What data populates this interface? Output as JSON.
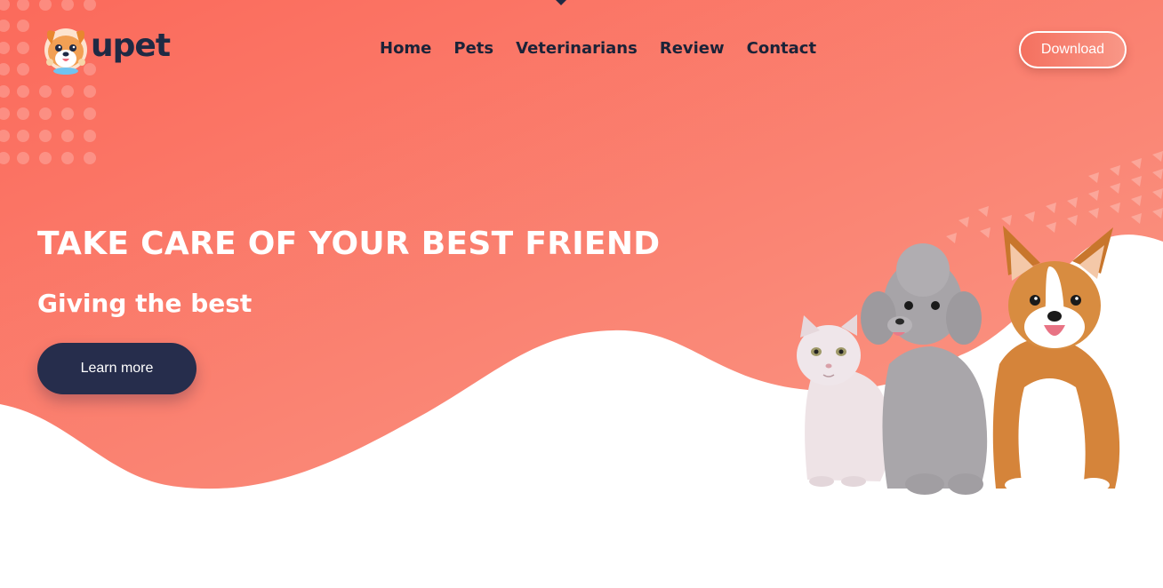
{
  "brand": {
    "name": "upet",
    "logo_icon": "dog-mascot-icon"
  },
  "nav": {
    "items": [
      {
        "label": "Home"
      },
      {
        "label": "Pets"
      },
      {
        "label": "Veterinarians"
      },
      {
        "label": "Review"
      },
      {
        "label": "Contact"
      }
    ]
  },
  "header": {
    "download_label": "Download"
  },
  "hero": {
    "headline": "TAKE CARE OF YOUR BEST FRIEND",
    "subheadline": "Giving the best",
    "cta_label": "Learn more",
    "image": "cat-poodle-corgi-photo"
  },
  "colors": {
    "hero_start": "#fb6b5c",
    "hero_end": "#fb8f7e",
    "navy": "#262d4c",
    "text_dark": "#1b2338",
    "white": "#ffffff"
  }
}
